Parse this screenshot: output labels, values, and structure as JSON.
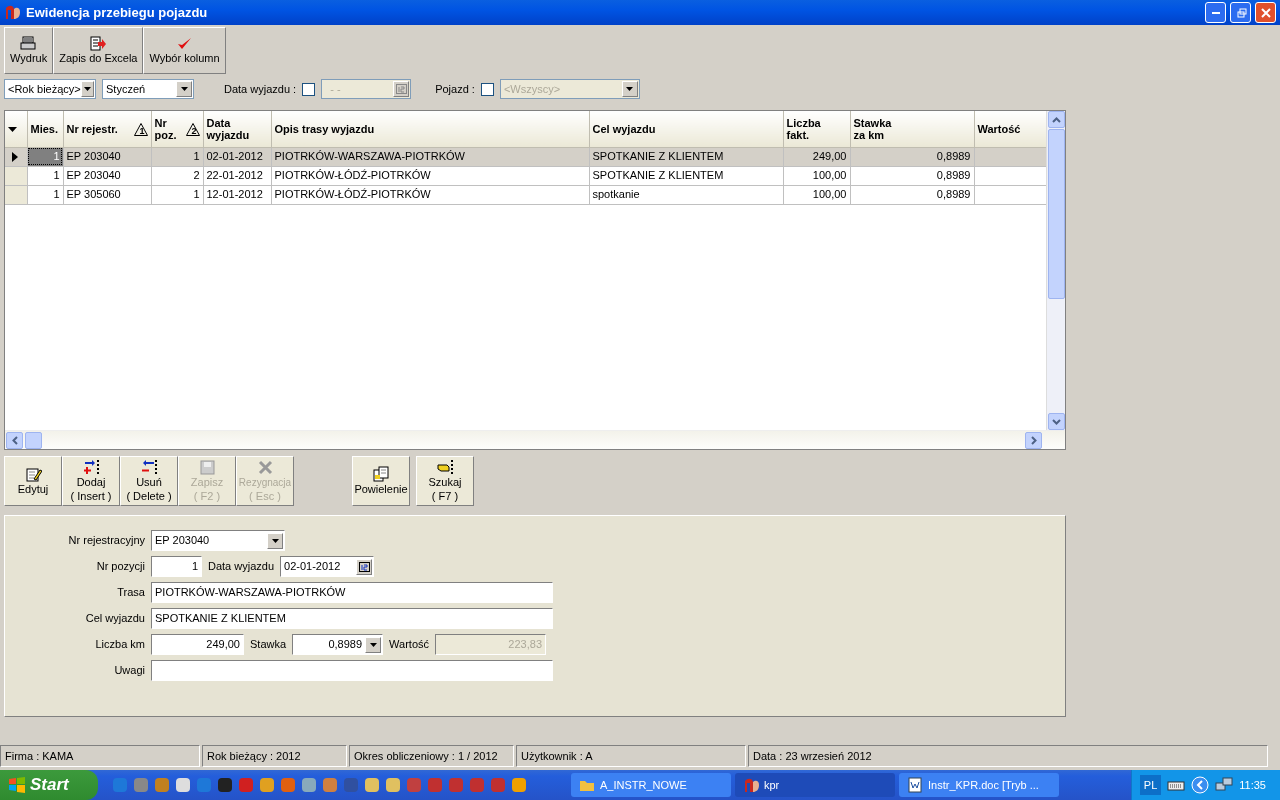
{
  "window": {
    "title": "Ewidencja przebiegu pojazdu"
  },
  "toolbar": [
    {
      "kind": "print",
      "label": "Wydruk"
    },
    {
      "kind": "excel",
      "label": "Zapis do Excela"
    },
    {
      "kind": "check",
      "label": "Wybór kolumn"
    }
  ],
  "filters": {
    "year": {
      "value": "<Rok bieżący>"
    },
    "month": {
      "value": "Styczeń"
    },
    "date": {
      "label": "Data wyjazdu :",
      "checked": false,
      "value": "- -",
      "disabled": true
    },
    "vehicle": {
      "label": "Pojazd :",
      "checked": false,
      "value": "<Wszyscy>",
      "disabled": true
    }
  },
  "table": {
    "columns": [
      {
        "label": "Mies."
      },
      {
        "label": "Nr rejestr.",
        "sort": "1"
      },
      {
        "label": "Nr poz.",
        "sort": "2"
      },
      {
        "label": "Data wyjazdu"
      },
      {
        "label": "Opis trasy wyjazdu"
      },
      {
        "label": "Cel wyjazdu"
      },
      {
        "label": "Liczba fakt."
      },
      {
        "label": "Stawka za km"
      },
      {
        "label": "Wartość"
      }
    ],
    "rows": [
      {
        "selected": true,
        "cells": [
          "1",
          "EP 203040",
          "1",
          "02-01-2012",
          "PIOTRKÓW-WARSZAWA-PIOTRKÓW",
          "SPOTKANIE Z KLIENTEM",
          "249,00",
          "0,8989"
        ]
      },
      {
        "selected": false,
        "cells": [
          "1",
          "EP 203040",
          "2",
          "22-01-2012",
          "PIOTRKÓW-ŁÓDŹ-PIOTRKÓW",
          "SPOTKANIE Z KLIENTEM",
          "100,00",
          "0,8989"
        ]
      },
      {
        "selected": false,
        "cells": [
          "1",
          "EP 305060",
          "1",
          "12-01-2012",
          "PIOTRKÓW-ŁÓDŹ-PIOTRKÓW",
          "spotkanie",
          "100,00",
          "0,8989"
        ]
      }
    ]
  },
  "actions": [
    {
      "kind": "edit",
      "label": "Edytuj",
      "disabled": false
    },
    {
      "kind": "add",
      "label": "Dodaj",
      "shortcut": "( Insert )",
      "disabled": false
    },
    {
      "kind": "delete",
      "label": "Usuń",
      "shortcut": "( Delete )",
      "disabled": false
    },
    {
      "kind": "save",
      "label": "Zapisz",
      "shortcut": "( F2 )",
      "disabled": true
    },
    {
      "kind": "cancel",
      "label": "Rezygnacja",
      "shortcut": "( Esc )",
      "disabled": true
    },
    {
      "kind": "copy",
      "label": "Powielenie",
      "disabled": false
    },
    {
      "kind": "find",
      "label": "Szukaj",
      "shortcut": "( F7 )",
      "disabled": false
    }
  ],
  "form": {
    "registration": {
      "label": "Nr rejestracyjny",
      "value": "EP 203040"
    },
    "position": {
      "label": "Nr pozycji",
      "value": "1"
    },
    "date": {
      "label": "Data wyjazdu",
      "value": "02-01-2012"
    },
    "route": {
      "label": "Trasa",
      "value": "PIOTRKÓW-WARSZAWA-PIOTRKÓW"
    },
    "purpose": {
      "label": "Cel wyjazdu",
      "value": "SPOTKANIE Z KLIENTEM"
    },
    "km": {
      "label": "Liczba km",
      "value": "249,00"
    },
    "rate": {
      "label": "Stawka",
      "value": "0,8989"
    },
    "amount": {
      "label": "Wartość",
      "value": "223,83",
      "disabled": true
    },
    "notes": {
      "label": "Uwagi"
    }
  },
  "status_bar": [
    "Firma : KAMA",
    "Rok bieżący : 2012",
    "Okres obliczeniowy : 1 / 2012",
    "Użytkownik : A",
    "Data : 23 wrzesień 2012"
  ],
  "taskbar": {
    "start": "Start",
    "tasks": [
      {
        "kind": "folder",
        "label": "A_INSTR_NOWE",
        "selected": false
      },
      {
        "kind": "app",
        "label": "kpr",
        "selected": true
      },
      {
        "kind": "doc",
        "label": "Instr_KPR.doc [Tryb ...",
        "selected": false
      }
    ],
    "language": "PL",
    "clock": "11:35"
  }
}
